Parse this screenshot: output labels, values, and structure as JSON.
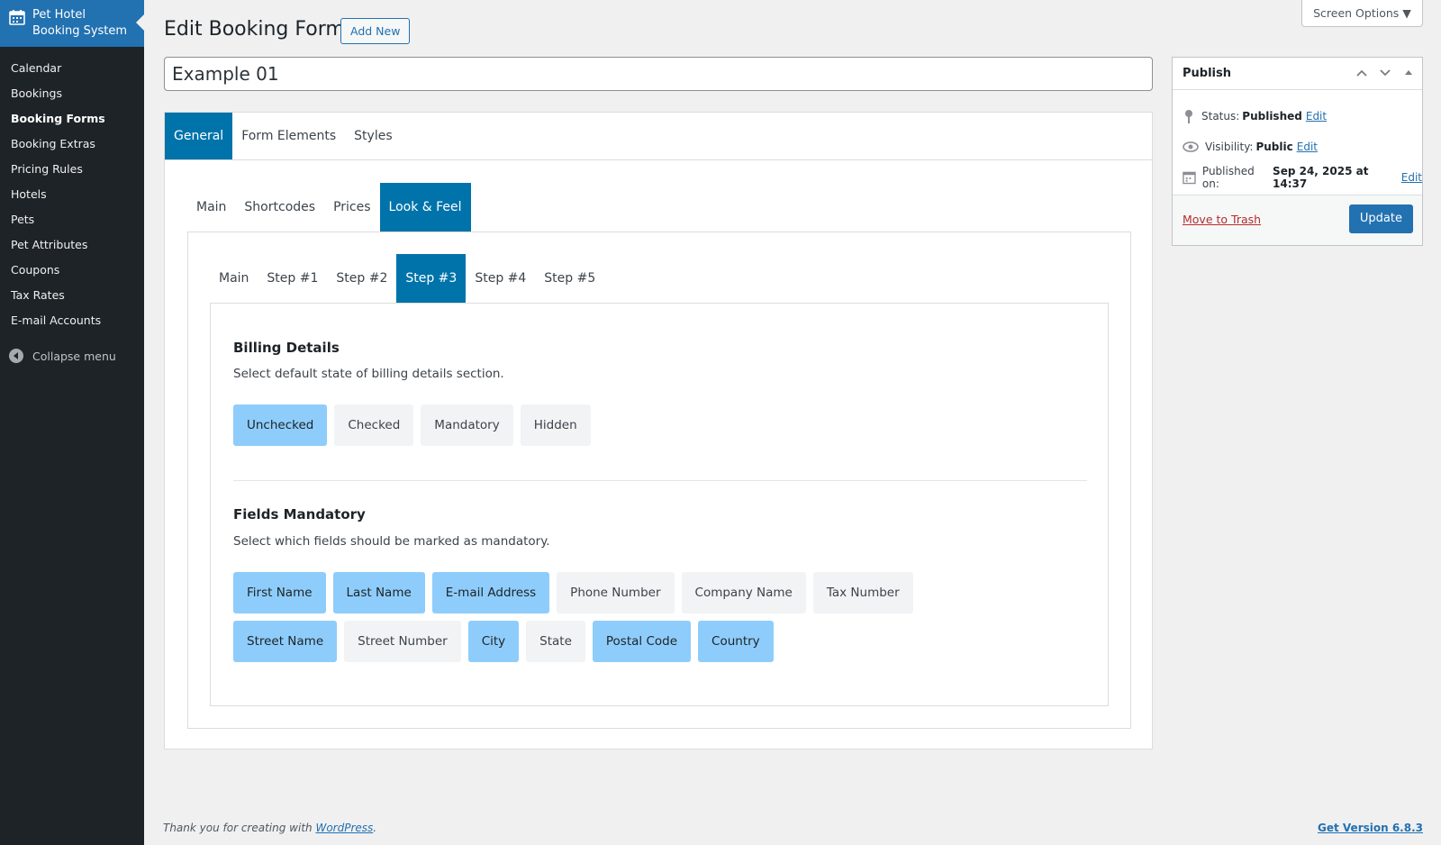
{
  "sidebar": {
    "brand_title_line1": "Pet Hotel",
    "brand_title_line2": "Booking System",
    "items": [
      {
        "label": "Calendar"
      },
      {
        "label": "Bookings"
      },
      {
        "label": "Booking Forms",
        "current": true
      },
      {
        "label": "Booking Extras"
      },
      {
        "label": "Pricing Rules"
      },
      {
        "label": "Hotels"
      },
      {
        "label": "Pets"
      },
      {
        "label": "Pet Attributes"
      },
      {
        "label": "Coupons"
      },
      {
        "label": "Tax Rates"
      },
      {
        "label": "E-mail Accounts"
      }
    ],
    "collapse_label": "Collapse menu"
  },
  "header": {
    "title": "Edit Booking Form",
    "add_new_label": "Add New",
    "screen_options_label": "Screen Options ▼"
  },
  "form": {
    "title_value": "Example 01"
  },
  "tabs_level1": [
    {
      "label": "General",
      "active": true
    },
    {
      "label": "Form Elements"
    },
    {
      "label": "Styles"
    }
  ],
  "tabs_level2": [
    {
      "label": "Main"
    },
    {
      "label": "Shortcodes"
    },
    {
      "label": "Prices"
    },
    {
      "label": "Look & Feel",
      "active": true
    }
  ],
  "tabs_level3": [
    {
      "label": "Main"
    },
    {
      "label": "Step #1"
    },
    {
      "label": "Step #2"
    },
    {
      "label": "Step #3",
      "active": true
    },
    {
      "label": "Step #4"
    },
    {
      "label": "Step #5"
    }
  ],
  "billing": {
    "title": "Billing Details",
    "description": "Select default state of billing details section.",
    "options": [
      {
        "label": "Unchecked",
        "selected": true
      },
      {
        "label": "Checked",
        "selected": false
      },
      {
        "label": "Mandatory",
        "selected": false
      },
      {
        "label": "Hidden",
        "selected": false
      }
    ]
  },
  "mandatory": {
    "title": "Fields Mandatory",
    "description": "Select which fields should be marked as mandatory.",
    "fields": [
      {
        "label": "First Name",
        "selected": true
      },
      {
        "label": "Last Name",
        "selected": true
      },
      {
        "label": "E-mail Address",
        "selected": true
      },
      {
        "label": "Phone Number",
        "selected": false
      },
      {
        "label": "Company Name",
        "selected": false
      },
      {
        "label": "Tax Number",
        "selected": false
      },
      {
        "label": "Street Name",
        "selected": true
      },
      {
        "label": "Street Number",
        "selected": false
      },
      {
        "label": "City",
        "selected": true
      },
      {
        "label": "State",
        "selected": false
      },
      {
        "label": "Postal Code",
        "selected": true
      },
      {
        "label": "Country",
        "selected": true
      }
    ]
  },
  "publish": {
    "title": "Publish",
    "status_label": "Status:",
    "status_value": "Published",
    "visibility_label": "Visibility:",
    "visibility_value": "Public",
    "published_label": "Published on:",
    "published_value": "Sep 24, 2025 at 14:37",
    "edit_label": "Edit",
    "trash_label": "Move to Trash",
    "update_label": "Update"
  },
  "footer": {
    "thanks_prefix": "Thank you for creating with ",
    "wp_link": "WordPress",
    "thanks_suffix": ".",
    "version_label": "Get Version 6.8.3"
  },
  "colors": {
    "sidebar_bg": "#1d2327",
    "brand_bg": "#2271b1",
    "tab_active": "#0073aa",
    "option_selected": "#8ecdfb",
    "option_default": "#f2f3f5",
    "trash": "#b32d2e"
  }
}
